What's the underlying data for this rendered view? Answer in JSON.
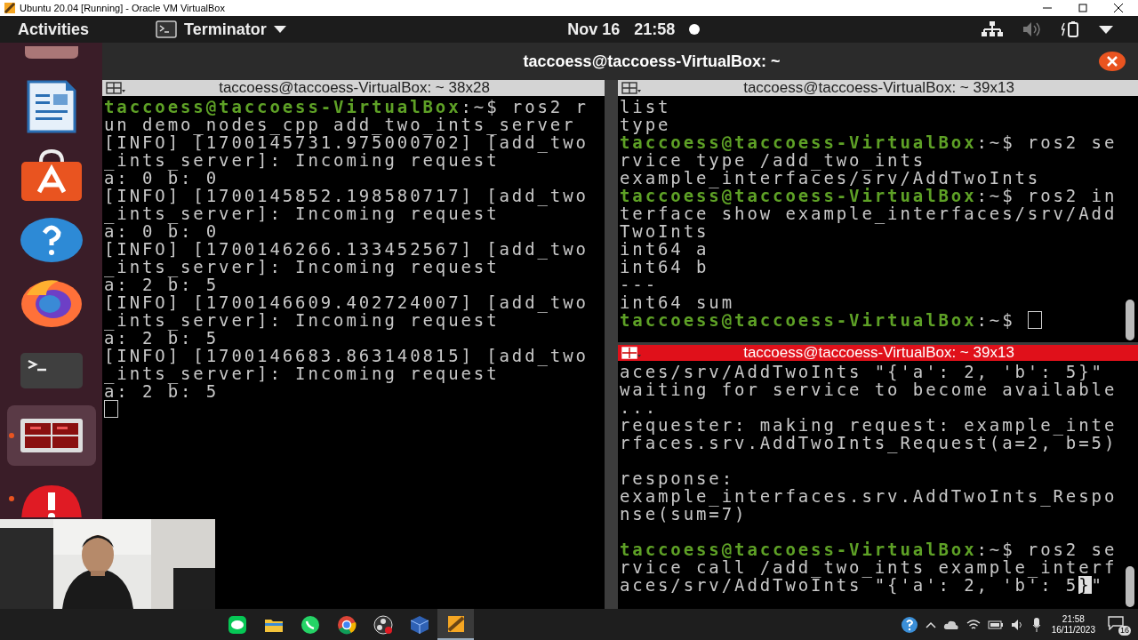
{
  "host_window": {
    "title": "Ubuntu 20.04 [Running] - Oracle VM VirtualBox"
  },
  "top_bar": {
    "activities": "Activities",
    "app_menu": "Terminator",
    "date": "Nov 16",
    "time": "21:58"
  },
  "dock": [
    {
      "kind": "partial",
      "running": false,
      "selected": false
    },
    {
      "kind": "writer",
      "running": false,
      "selected": false
    },
    {
      "kind": "store",
      "running": false,
      "selected": false
    },
    {
      "kind": "help",
      "running": false,
      "selected": false
    },
    {
      "kind": "firefox",
      "running": false,
      "selected": false
    },
    {
      "kind": "terminal",
      "running": false,
      "selected": false
    },
    {
      "kind": "terminator",
      "running": true,
      "selected": true
    },
    {
      "kind": "alert",
      "running": true,
      "selected": false
    }
  ],
  "terminator": {
    "title": "taccoess@taccoess-VirtualBox: ~",
    "panes": [
      {
        "title": "taccoess@taccoess-VirtualBox: ~ 38x28",
        "focused": false,
        "lines": [
          {
            "kind": "prompt",
            "prompt": "taccoess@taccoess-VirtualBox",
            "text": ":~$ ros2 r"
          },
          {
            "kind": "output",
            "text": "un demo_nodes_cpp add_two_ints_server"
          },
          {
            "kind": "output",
            "text": "[INFO] [1700145731.975000702] [add_two"
          },
          {
            "kind": "output",
            "text": "_ints_server]: Incoming request"
          },
          {
            "kind": "output",
            "text": "a: 0 b: 0"
          },
          {
            "kind": "output",
            "text": "[INFO] [1700145852.198580717] [add_two"
          },
          {
            "kind": "output",
            "text": "_ints_server]: Incoming request"
          },
          {
            "kind": "output",
            "text": "a: 0 b: 0"
          },
          {
            "kind": "output",
            "text": "[INFO] [1700146266.133452567] [add_two"
          },
          {
            "kind": "output",
            "text": "_ints_server]: Incoming request"
          },
          {
            "kind": "output",
            "text": "a: 2 b: 5"
          },
          {
            "kind": "output",
            "text": "[INFO] [1700146609.402724007] [add_two"
          },
          {
            "kind": "output",
            "text": "_ints_server]: Incoming request"
          },
          {
            "kind": "output",
            "text": "a: 2 b: 5"
          },
          {
            "kind": "output",
            "text": "[INFO] [1700146683.863140815] [add_two"
          },
          {
            "kind": "output",
            "text": "_ints_server]: Incoming request"
          },
          {
            "kind": "output",
            "text": "a: 2 b: 5"
          },
          {
            "kind": "cursor"
          }
        ]
      },
      {
        "title": "taccoess@taccoess-VirtualBox: ~ 39x13",
        "focused": false,
        "lines": [
          {
            "kind": "output",
            "text": "list"
          },
          {
            "kind": "output",
            "text": "type"
          },
          {
            "kind": "prompt",
            "prompt": "taccoess@taccoess-VirtualBox",
            "text": ":~$ ros2 se"
          },
          {
            "kind": "output",
            "text": "rvice type /add_two_ints"
          },
          {
            "kind": "output",
            "text": "example_interfaces/srv/AddTwoInts"
          },
          {
            "kind": "prompt",
            "prompt": "taccoess@taccoess-VirtualBox",
            "text": ":~$ ros2 in"
          },
          {
            "kind": "output",
            "text": "terface show example_interfaces/srv/Add"
          },
          {
            "kind": "output",
            "text": "TwoInts"
          },
          {
            "kind": "output",
            "text": "int64 a"
          },
          {
            "kind": "output",
            "text": "int64 b"
          },
          {
            "kind": "output",
            "text": "---"
          },
          {
            "kind": "output",
            "text": "int64 sum"
          },
          {
            "kind": "prompt",
            "prompt": "taccoess@taccoess-VirtualBox",
            "text": ":~$ ",
            "cursor": true
          }
        ]
      },
      {
        "title": "taccoess@taccoess-VirtualBox: ~ 39x13",
        "focused": true,
        "lines": [
          {
            "kind": "output",
            "text": "aces/srv/AddTwoInts \"{'a': 2, 'b': 5}\""
          },
          {
            "kind": "output",
            "text": "waiting for service to become available"
          },
          {
            "kind": "output",
            "text": "..."
          },
          {
            "kind": "output",
            "text": "requester: making request: example_inte"
          },
          {
            "kind": "output",
            "text": "rfaces.srv.AddTwoInts_Request(a=2, b=5)"
          },
          {
            "kind": "blank"
          },
          {
            "kind": "output",
            "text": "response:"
          },
          {
            "kind": "output",
            "text": "example_interfaces.srv.AddTwoInts_Respo"
          },
          {
            "kind": "output",
            "text": "nse(sum=7)"
          },
          {
            "kind": "blank"
          },
          {
            "kind": "prompt",
            "prompt": "taccoess@taccoess-VirtualBox",
            "text": ":~$ ros2 se"
          },
          {
            "kind": "output",
            "text": "rvice call /add_two_ints example_interf"
          },
          {
            "kind": "output",
            "text": "aces/srv/AddTwoInts \"{'a': 2, 'b': 5",
            "cursor_char": "}",
            "after": "\""
          }
        ]
      }
    ]
  },
  "taskbar": {
    "apps": [
      {
        "kind": "line",
        "selected": false
      },
      {
        "kind": "explorer",
        "selected": false
      },
      {
        "kind": "whatsapp",
        "selected": false
      },
      {
        "kind": "chrome",
        "selected": false
      },
      {
        "kind": "obs",
        "selected": false
      },
      {
        "kind": "virtualbox",
        "selected": false
      },
      {
        "kind": "vm",
        "selected": true
      }
    ],
    "time": "21:58",
    "date": "16/11/2023",
    "notifications": "16"
  }
}
